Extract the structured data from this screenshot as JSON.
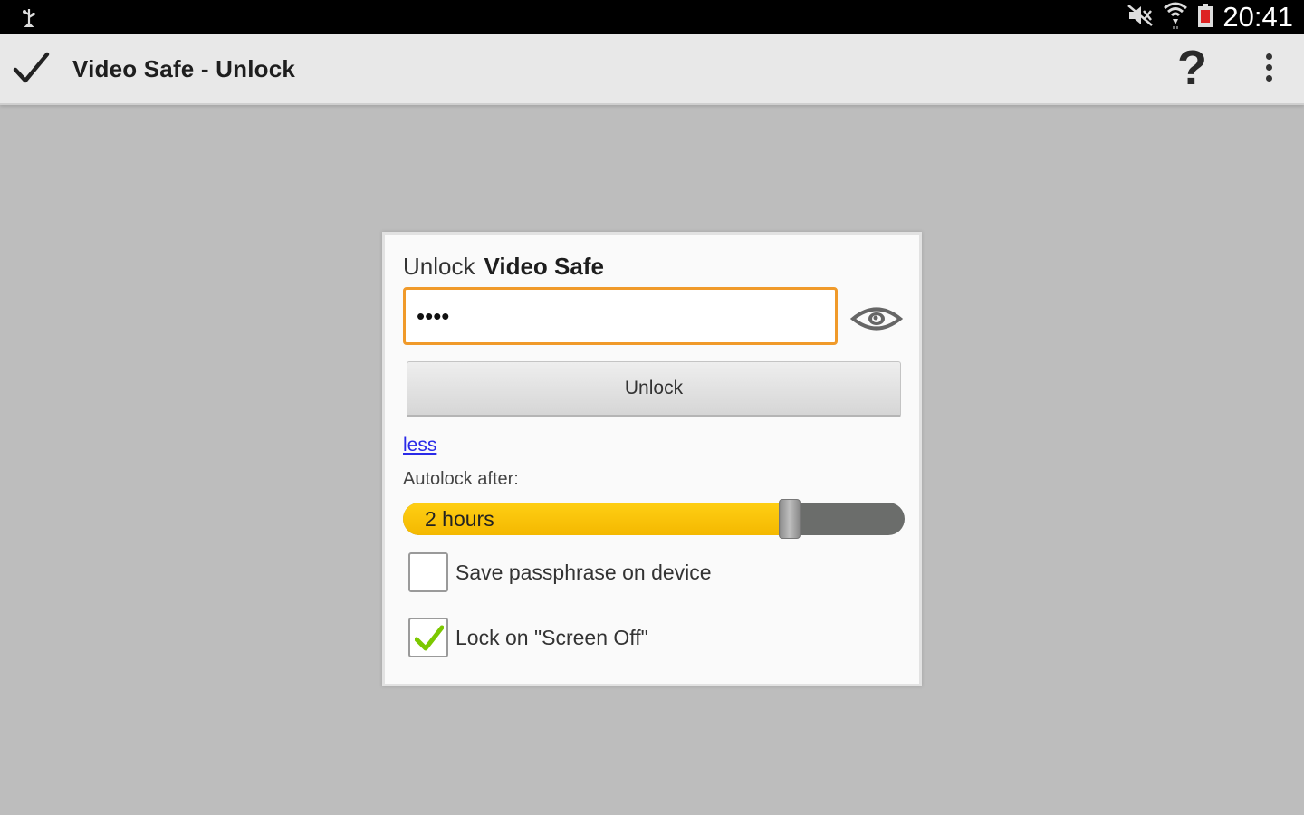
{
  "status_bar": {
    "time": "20:41",
    "icons": [
      "usb-icon",
      "mute-icon",
      "wifi-icon",
      "battery-icon"
    ]
  },
  "action_bar": {
    "title": "Video Safe - Unlock",
    "help_label": "?",
    "icons": [
      "check-icon",
      "overflow-menu-icon"
    ]
  },
  "dialog": {
    "title_prefix": "Unlock",
    "title_app": "Video Safe",
    "passphrase_value": "••••",
    "unlock_label": "Unlock",
    "less_link": "less",
    "autolock_label": "Autolock after:",
    "autolock_value": "2 hours",
    "autolock_fraction": 0.77,
    "save_passphrase_label": "Save passphrase on device",
    "save_passphrase_checked": false,
    "lock_screen_off_label": "Lock on \"Screen Off\"",
    "lock_screen_off_checked": true
  },
  "colors": {
    "accent_orange": "#f09a2a",
    "slider_yellow": "#ffcf14",
    "link_blue": "#2a2ae8",
    "check_green": "#7cc800"
  }
}
